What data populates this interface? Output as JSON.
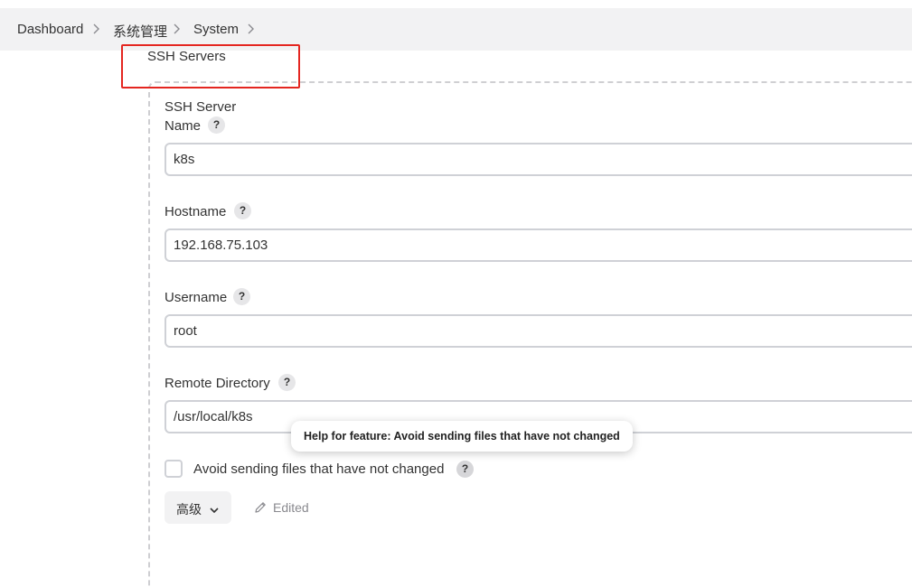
{
  "breadcrumb": {
    "items": [
      {
        "label": "Dashboard"
      },
      {
        "label": "系统管理"
      },
      {
        "label": "System"
      }
    ]
  },
  "section": {
    "title": "SSH Servers"
  },
  "server": {
    "heading": "SSH Server",
    "fields": {
      "name": {
        "label": "Name",
        "value": "k8s"
      },
      "hostname": {
        "label": "Hostname",
        "value": "192.168.75.103"
      },
      "username": {
        "label": "Username",
        "value": "root"
      },
      "remote_directory": {
        "label": "Remote Directory",
        "value": "/usr/local/k8s"
      }
    },
    "help_symbol": "?",
    "avoid_sending": {
      "label": "Avoid sending files that have not changed",
      "checked": false
    },
    "tooltip": "Help for feature: Avoid sending files that have not changed",
    "advanced_button": {
      "label": "高级"
    },
    "edited_label": "Edited"
  },
  "colors": {
    "highlight": "#e42620",
    "breadcrumb_bg": "#f2f2f3",
    "field_border": "#cfd1d6",
    "dashed_border": "#cfcfd2"
  },
  "icons": {
    "breadcrumb_separator": "chevron-right-icon",
    "advanced_toggle": "chevron-down-icon",
    "edited": "pencil-icon",
    "help": "help-icon"
  }
}
